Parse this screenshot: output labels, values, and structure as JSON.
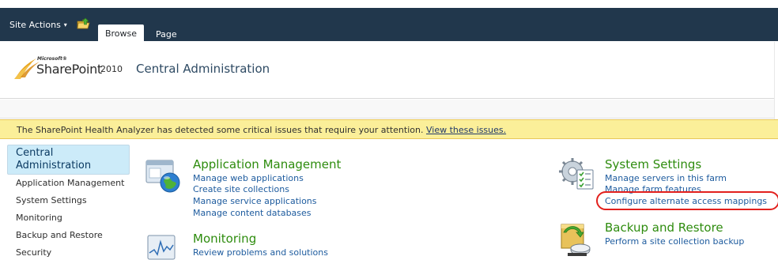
{
  "ribbon": {
    "site_actions_label": "Site Actions",
    "site_actions_caret": "▾",
    "tabs": [
      {
        "label": "Browse",
        "selected": true
      },
      {
        "label": "Page",
        "selected": false
      }
    ],
    "bg_color": "#21374c"
  },
  "header": {
    "logo_microsoft": "Microsoft®",
    "logo_sharepoint": "SharePoint",
    "logo_year": "2010",
    "site_title": "Central Administration"
  },
  "health_banner": {
    "message": "The SharePoint Health Analyzer has detected some critical issues that require your attention.",
    "link_text": "View these issues.",
    "bg_color": "#fbef99"
  },
  "left_nav": {
    "header_label": "Central Administration",
    "items": [
      "Application Management",
      "System Settings",
      "Monitoring",
      "Backup and Restore",
      "Security"
    ]
  },
  "sections": {
    "application_management": {
      "title": "Application Management",
      "icon": "application-management-icon",
      "links": [
        "Manage web applications",
        "Create site collections",
        "Manage service applications",
        "Manage content databases"
      ]
    },
    "monitoring": {
      "title": "Monitoring",
      "icon": "monitoring-icon",
      "links": [
        "Review problems and solutions"
      ]
    },
    "system_settings": {
      "title": "System Settings",
      "icon": "system-settings-icon",
      "links": [
        "Manage servers in this farm",
        "Manage farm features",
        "Configure alternate access mappings"
      ]
    },
    "backup_and_restore": {
      "title": "Backup and Restore",
      "icon": "backup-restore-icon",
      "links": [
        "Perform a site collection backup"
      ]
    }
  },
  "colors": {
    "section_title": "#2e8c0e",
    "link": "#1d5b9e",
    "highlight": "#e2201d"
  }
}
